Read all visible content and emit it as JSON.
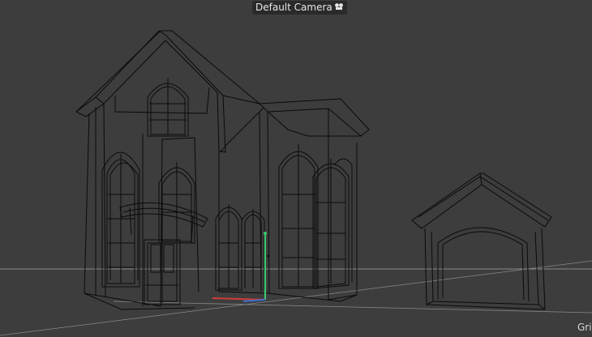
{
  "viewport": {
    "camera_label": "Default Camera",
    "camera_icon": "camera-icon",
    "grid_label": "Grid",
    "display_mode": "wireframe"
  },
  "colors": {
    "background": "#3d3d3d",
    "wire": "#0a0a0a",
    "grid_line": "#8a8a8a",
    "axis_x": "#d23c3c",
    "axis_y": "#3cc86e",
    "axis_z": "#3c6ed2"
  }
}
